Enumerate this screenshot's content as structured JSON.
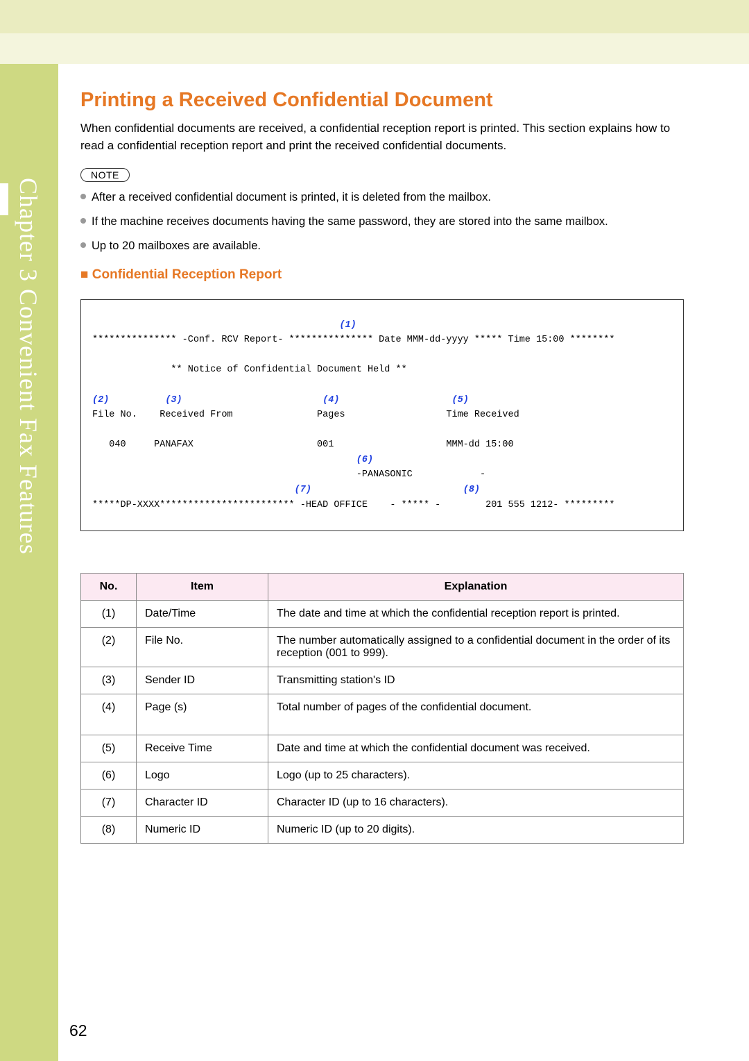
{
  "sidebar": {
    "chapter_label": "Chapter 3  Convenient Fax Features"
  },
  "page": {
    "title": "Printing a Received Confidential Document",
    "intro": "When confidential documents are received, a confidential reception report is printed. This section explains how to read a confidential reception report and print the received confidential documents.",
    "note_label": "NOTE",
    "notes": [
      "After a received confidential document is printed, it is deleted from the mailbox.",
      "If the machine receives documents having the same password, they are stored into the same mailbox.",
      "Up to 20 mailboxes are available."
    ],
    "subhead": "Confidential Reception Report"
  },
  "report": {
    "m1": "(1)",
    "line1": "*************** -Conf. RCV Report- *************** Date MMM-dd-yyyy ***** Time 15:00 ********",
    "line_notice": "** Notice of Confidential Document Held **",
    "m2": "(2)",
    "m3": "(3)",
    "m4": "(4)",
    "m5": "(5)",
    "header_cols": "File No.    Received From               Pages                  Time Received",
    "data_row": "   040     PANAFAX                      001                    MMM-dd 15:00",
    "m6": "(6)",
    "line_logo": "-PANASONIC            -",
    "m7": "(7)",
    "m8": "(8)",
    "line_footer": "*****DP-XXXX************************ -HEAD OFFICE    - ***** -        201 555 1212- *********"
  },
  "table": {
    "head": {
      "no": "No.",
      "item": "Item",
      "exp": "Explanation"
    },
    "rows": [
      {
        "no": "(1)",
        "item": "Date/Time",
        "exp": "The date and time at which the confidential reception report is printed."
      },
      {
        "no": "(2)",
        "item": "File No.",
        "exp": "The number automatically assigned to a confidential document in the order of its reception (001 to 999)."
      },
      {
        "no": "(3)",
        "item": "Sender ID",
        "exp": "Transmitting station's ID"
      },
      {
        "no": "(4)",
        "item": "Page (s)",
        "exp": "Total number of pages of the confidential document."
      },
      {
        "no": "(5)",
        "item": "Receive Time",
        "exp": "Date and time at which the confidential document was received."
      },
      {
        "no": "(6)",
        "item": "Logo",
        "exp": "Logo (up to 25 characters)."
      },
      {
        "no": "(7)",
        "item": "Character ID",
        "exp": "Character ID (up to 16 characters)."
      },
      {
        "no": "(8)",
        "item": "Numeric ID",
        "exp": "Numeric ID (up to 20 digits)."
      }
    ]
  },
  "page_number": "62"
}
